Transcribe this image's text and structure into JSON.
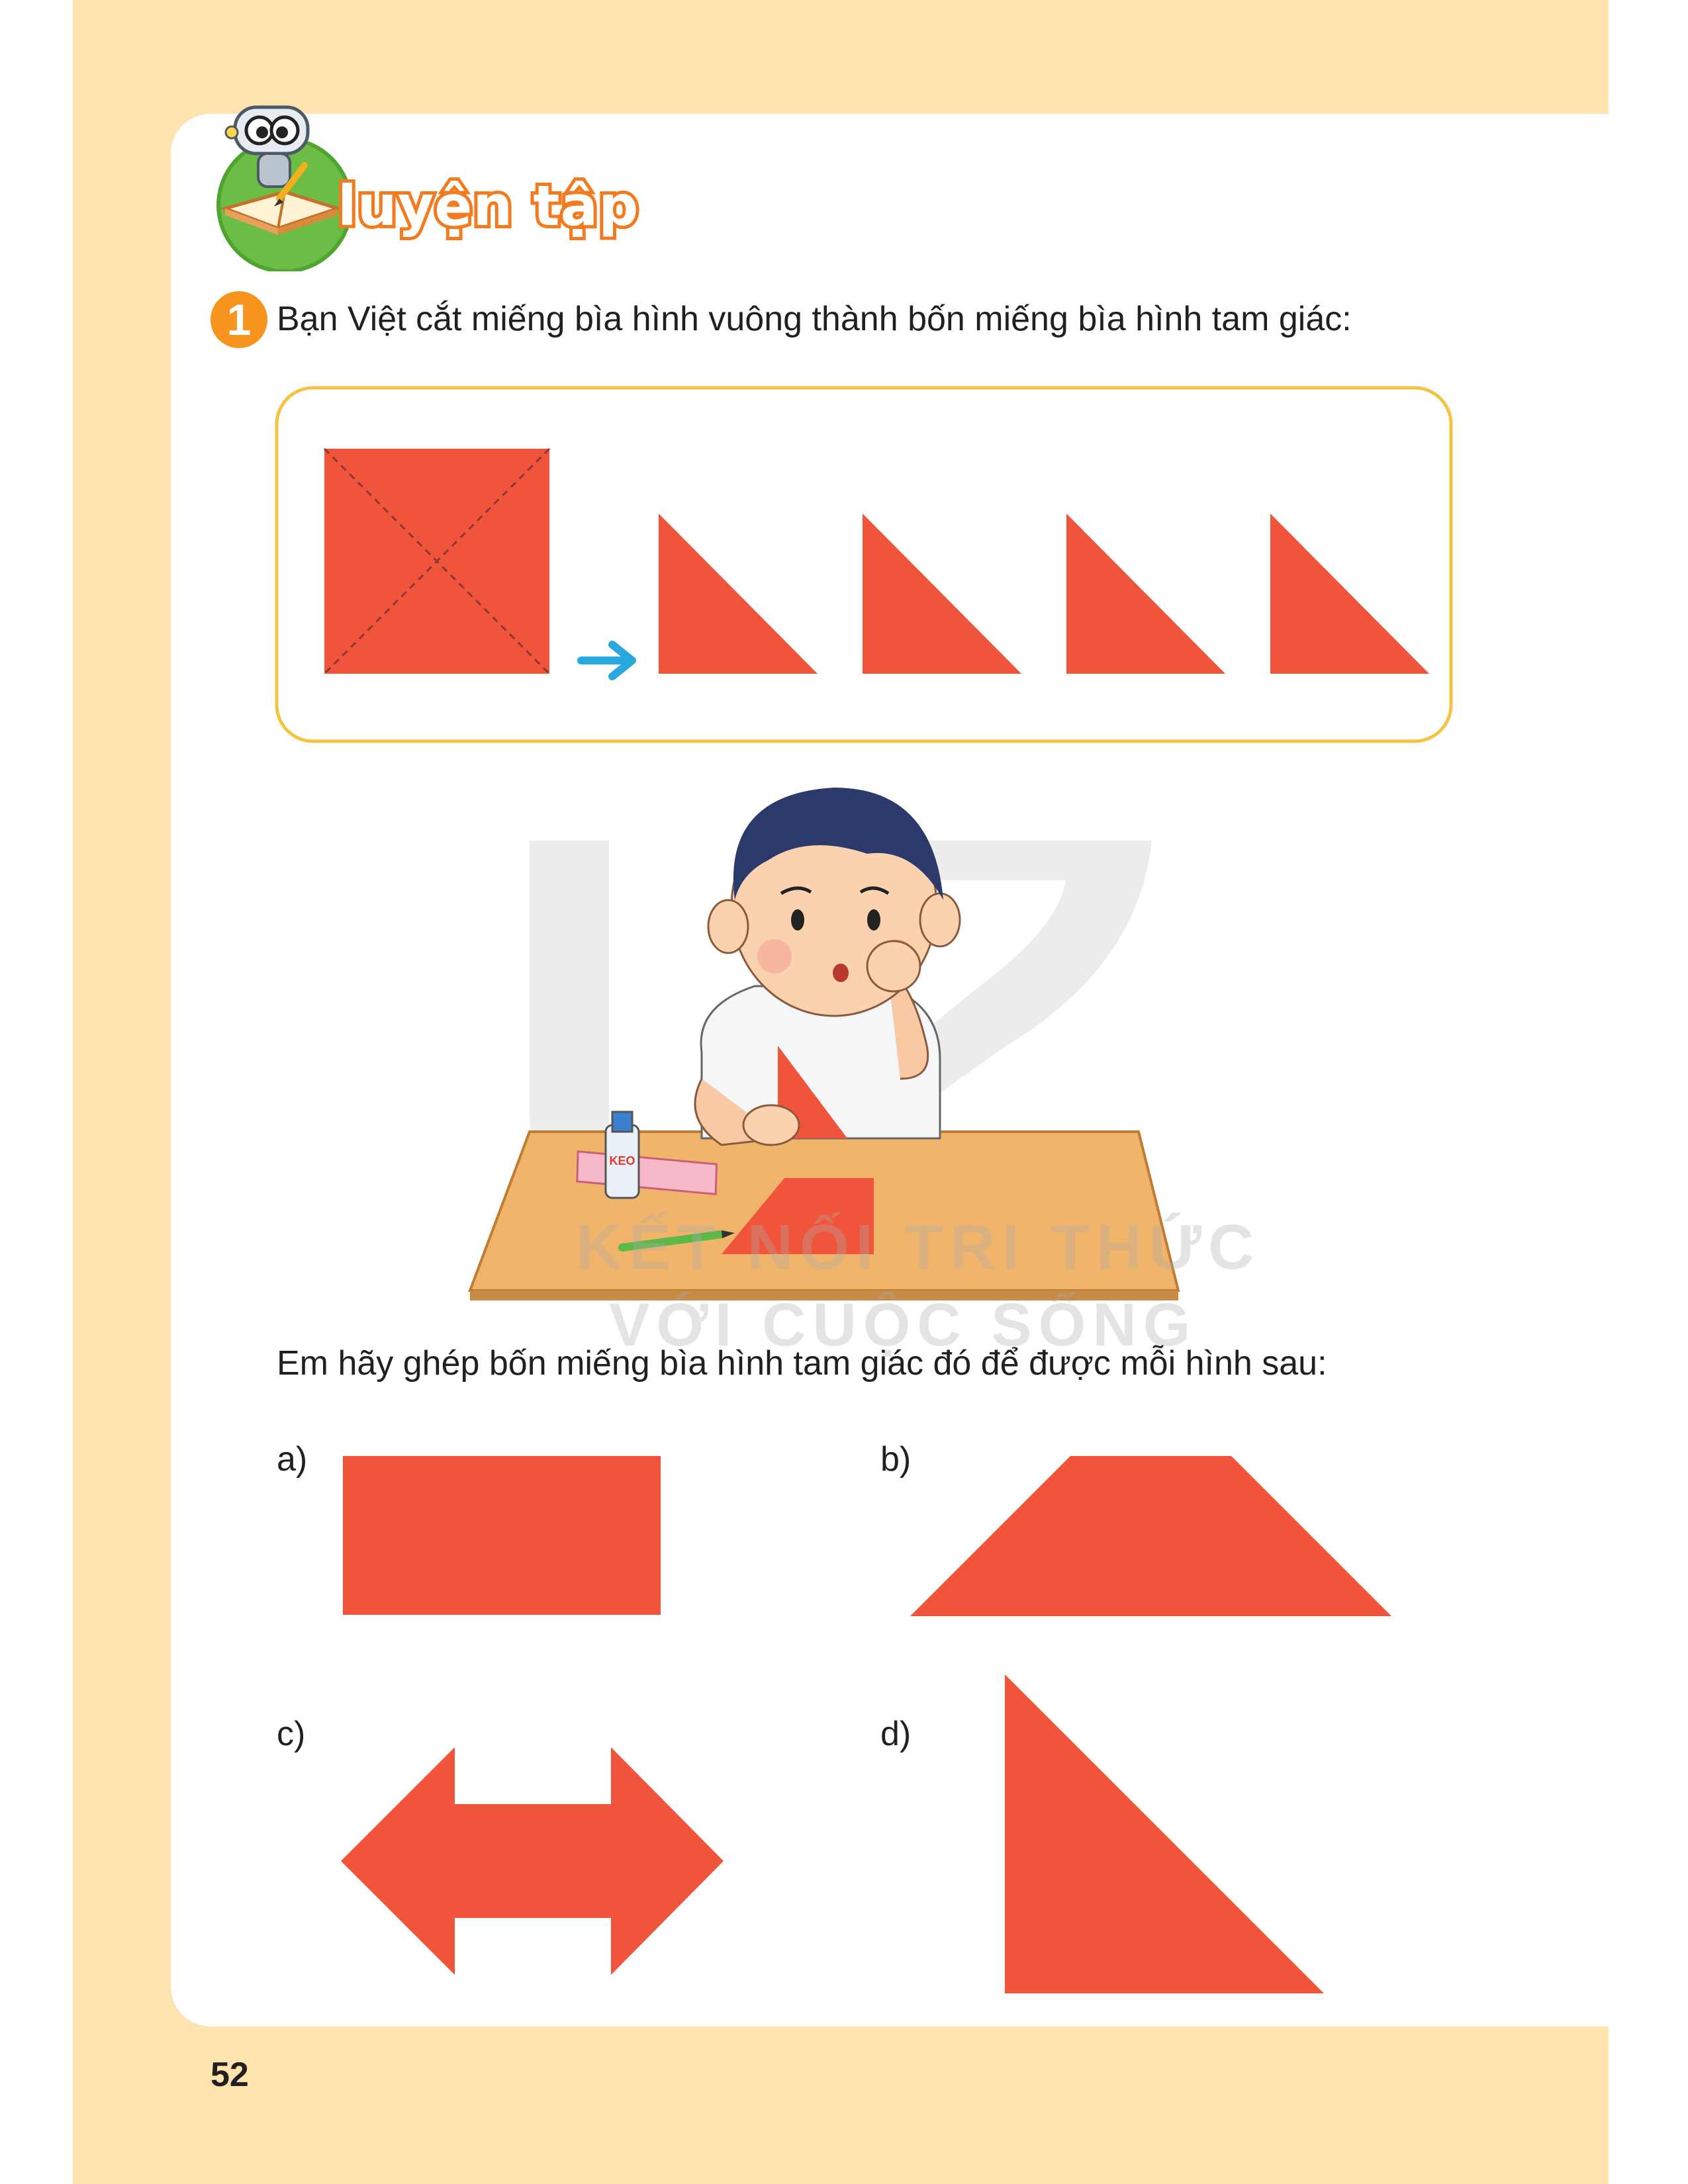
{
  "section": {
    "title": "luyện tập"
  },
  "exercise": {
    "number": "1",
    "instruction": "Bạn Việt cắt miếng bìa hình vuông thành bốn miếng bìa hình tam giác:",
    "task": "Em hãy ghép bốn miếng bìa hình tam giác đó để được mỗi hình sau:",
    "options": [
      {
        "label": "a)",
        "shape": "rectangle"
      },
      {
        "label": "b)",
        "shape": "trapezoid"
      },
      {
        "label": "c)",
        "shape": "double-arrow"
      },
      {
        "label": "d)",
        "shape": "right-triangle"
      }
    ]
  },
  "illustration": {
    "glue_label": "KEO"
  },
  "watermark": {
    "line1": "KẾT NỐI TRI THỨC",
    "line2": "VỚI CUỘC SỐNG"
  },
  "colors": {
    "shape": "#f0543a",
    "page_background": "#fde3ad",
    "frame_border": "#f5c342",
    "arrow": "#29a8e0",
    "badge": "#f7941d",
    "title_stroke": "#f47a20"
  },
  "page_number": "52"
}
